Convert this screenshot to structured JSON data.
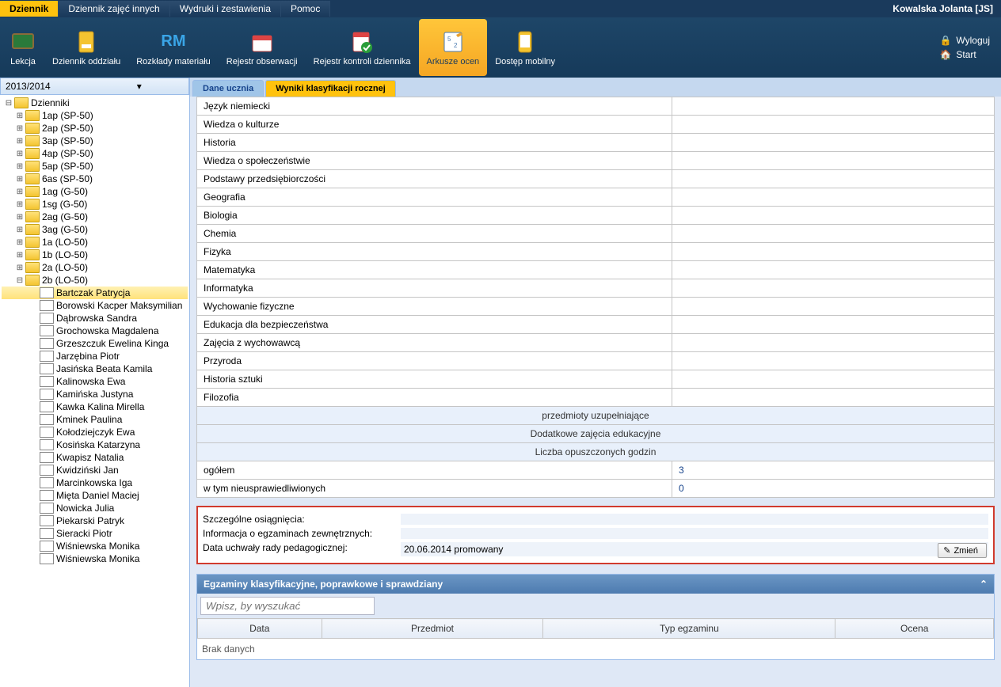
{
  "user_name": "Kowalska Jolanta [JS]",
  "top_tabs": [
    "Dziennik",
    "Dziennik zajęć innych",
    "Wydruki i zestawienia",
    "Pomoc"
  ],
  "ribbon": {
    "items": [
      {
        "label": "Lekcja"
      },
      {
        "label": "Dziennik oddziału"
      },
      {
        "label": "Rozkłady materiału"
      },
      {
        "label": "Rejestr obserwacji"
      },
      {
        "label": "Rejestr kontroli dziennika"
      },
      {
        "label": "Arkusze ocen"
      },
      {
        "label": "Dostęp mobilny"
      }
    ],
    "logout": "Wyloguj",
    "start": "Start"
  },
  "year": "2013/2014",
  "tree": {
    "root": "Dzienniki",
    "folders": [
      "1ap (SP-50)",
      "2ap (SP-50)",
      "3ap (SP-50)",
      "4ap (SP-50)",
      "5ap (SP-50)",
      "6as (SP-50)",
      "1ag (G-50)",
      "1sg (G-50)",
      "2ag (G-50)",
      "3ag (G-50)",
      "1a (LO-50)",
      "1b (LO-50)",
      "2a (LO-50)",
      "2b (LO-50)"
    ],
    "students": [
      "Bartczak Patrycja",
      "Borowski Kacper Maksymilian",
      "Dąbrowska Sandra",
      "Grochowska Magdalena",
      "Grzeszczuk Ewelina Kinga",
      "Jarzębina Piotr",
      "Jasińska Beata Kamila",
      "Kalinowska Ewa",
      "Kamińska Justyna",
      "Kawka Kalina Mirella",
      "Kminek Paulina",
      "Kołodziejczyk Ewa",
      "Kosińska Katarzyna",
      "Kwapisz Natalia",
      "Kwidziński Jan",
      "Marcinkowska Iga",
      "Mięta Daniel Maciej",
      "Nowicka Julia",
      "Piekarski Patryk",
      "Sieracki Piotr",
      "Wiśniewska Monika",
      "Wiśniewska Monika"
    ]
  },
  "content_tabs": [
    "Dane ucznia",
    "Wyniki klasyfikacji rocznej"
  ],
  "subjects": [
    "Język niemiecki",
    "Wiedza o kulturze",
    "Historia",
    "Wiedza o społeczeństwie",
    "Podstawy przedsiębiorczości",
    "Geografia",
    "Biologia",
    "Chemia",
    "Fizyka",
    "Matematyka",
    "Informatyka",
    "Wychowanie fizyczne",
    "Edukacja dla bezpieczeństwa",
    "Zajęcia z wychowawcą",
    "Przyroda",
    "Historia sztuki",
    "Filozofia"
  ],
  "sections": {
    "uzup": "przedmioty uzupełniające",
    "dodat": "Dodatkowe zajęcia edukacyjne",
    "liczba": "Liczba opuszczonych godzin"
  },
  "hours": {
    "ogolem_label": "ogółem",
    "ogolem_value": "3",
    "nieuspr_label": "w tym nieusprawiedliwionych",
    "nieuspr_value": "0"
  },
  "info": {
    "osiagniecia_label": "Szczególne osiągnięcia:",
    "egzaminy_label": "Informacja o egzaminach zewnętrznych:",
    "uchwala_label": "Data uchwały rady pedagogicznej:",
    "uchwala_value": "20.06.2014 promowany",
    "zmien": "Zmień"
  },
  "exam_panel": {
    "title": "Egzaminy klasyfikacyjne, poprawkowe i sprawdziany",
    "search_placeholder": "Wpisz, by wyszukać",
    "cols": [
      "Data",
      "Przedmiot",
      "Typ egzaminu",
      "Ocena"
    ],
    "nodata": "Brak danych"
  }
}
